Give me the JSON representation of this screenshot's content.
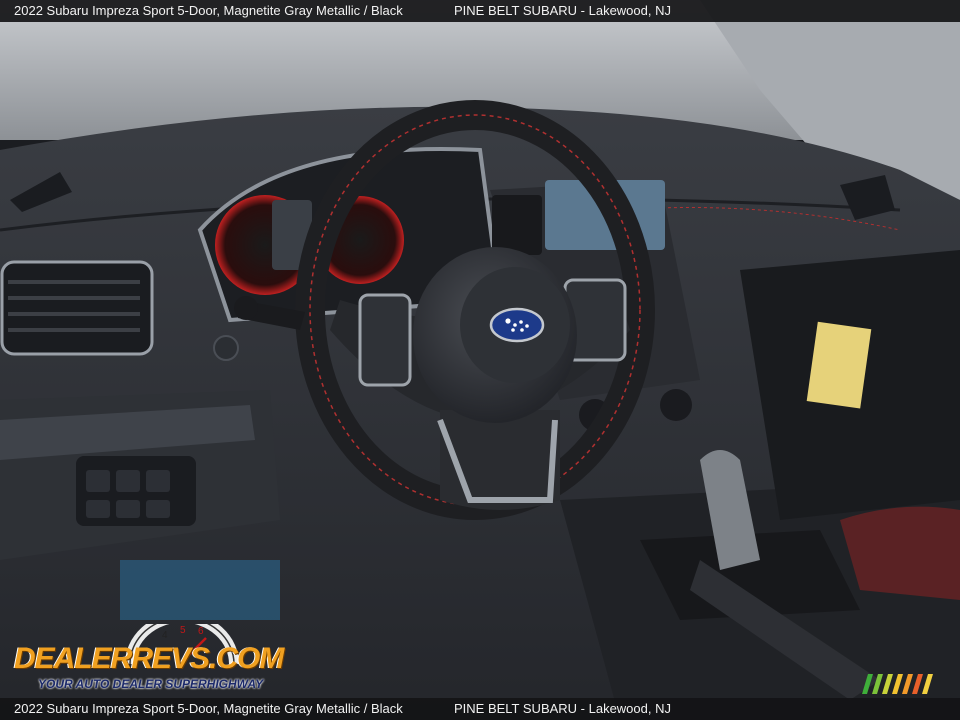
{
  "caption": {
    "title": "2022 Subaru Impreza Sport 5-Door,   Magnetite Gray Metallic / Black",
    "dealer": "PINE BELT SUBARU  -  Lakewood, NJ"
  },
  "watermark": {
    "brand": "DealerRevs.com",
    "brand_display": "DEALERREVS.COM",
    "tagline": "YOUR AUTO DEALER SUPERHIGHWAY"
  },
  "colors": {
    "dash": "#2a2d33",
    "stitching": "#b03030",
    "logo_orange": "#f0a020",
    "logo_blue": "#1c2a6a"
  }
}
